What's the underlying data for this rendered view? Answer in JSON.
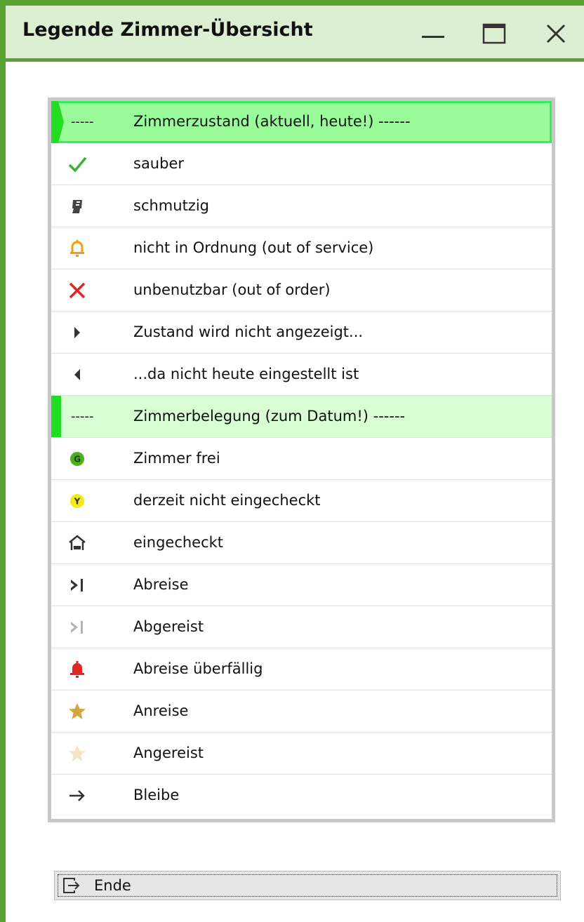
{
  "window": {
    "title": "Legende Zimmer-Übersicht",
    "controls": {
      "minimize": "minimize-icon",
      "maximize": "maximize-icon",
      "close": "close-icon"
    }
  },
  "legend": {
    "rows": [
      {
        "type": "section",
        "prefix": "-----",
        "label": "Zimmerzustand (aktuell, heute!) ------"
      },
      {
        "type": "item",
        "icon": "check-icon",
        "color": "#3fb13b",
        "label": "sauber"
      },
      {
        "type": "item",
        "icon": "dirty-icon",
        "color": "#444444",
        "label": "schmutzig"
      },
      {
        "type": "item",
        "icon": "bell-outline-icon",
        "color": "#f39c12",
        "label": "nicht in Ordnung (out of service)"
      },
      {
        "type": "item",
        "icon": "cross-icon",
        "color": "#e02525",
        "label": "unbenutzbar (out of order)"
      },
      {
        "type": "item",
        "icon": "triangle-right-icon",
        "color": "#333333",
        "label": "Zustand wird nicht angezeigt..."
      },
      {
        "type": "item",
        "icon": "triangle-left-icon",
        "color": "#333333",
        "label": "...da nicht heute eingestellt ist"
      },
      {
        "type": "section",
        "prefix": "-----",
        "label": "Zimmerbelegung (zum Datum!) ------"
      },
      {
        "type": "item",
        "icon": "green-circle-icon",
        "badge": "G",
        "color": "#4caf22",
        "label": "Zimmer frei"
      },
      {
        "type": "item",
        "icon": "yellow-circle-icon",
        "badge": "Y",
        "color": "#f2ea1d",
        "label": "derzeit nicht eingecheckt"
      },
      {
        "type": "item",
        "icon": "house-bed-icon",
        "color": "#333333",
        "label": "eingecheckt"
      },
      {
        "type": "item",
        "icon": "departure-icon",
        "color": "#333333",
        "label": "Abreise"
      },
      {
        "type": "item",
        "icon": "departed-icon",
        "color": "#b3b3b3",
        "label": "Abgereist"
      },
      {
        "type": "item",
        "icon": "bell-filled-icon",
        "color": "#e02525",
        "label": "Abreise überfällig"
      },
      {
        "type": "item",
        "icon": "star-icon",
        "color": "#d4a640",
        "label": "Anreise"
      },
      {
        "type": "item",
        "icon": "star-pale-icon",
        "color": "#f5e4c3",
        "label": "Angereist"
      },
      {
        "type": "item",
        "icon": "arrow-right-icon",
        "color": "#333333",
        "label": "Bleibe"
      }
    ]
  },
  "footer": {
    "ende_icon": "exit-icon",
    "ende_label": "Ende"
  },
  "colors": {
    "frame": "#5aa234",
    "titlebar": "#dcefd3",
    "section_current": "#99fb99",
    "section_booking": "#d8fcd4",
    "section_marker": "#22dd22"
  }
}
